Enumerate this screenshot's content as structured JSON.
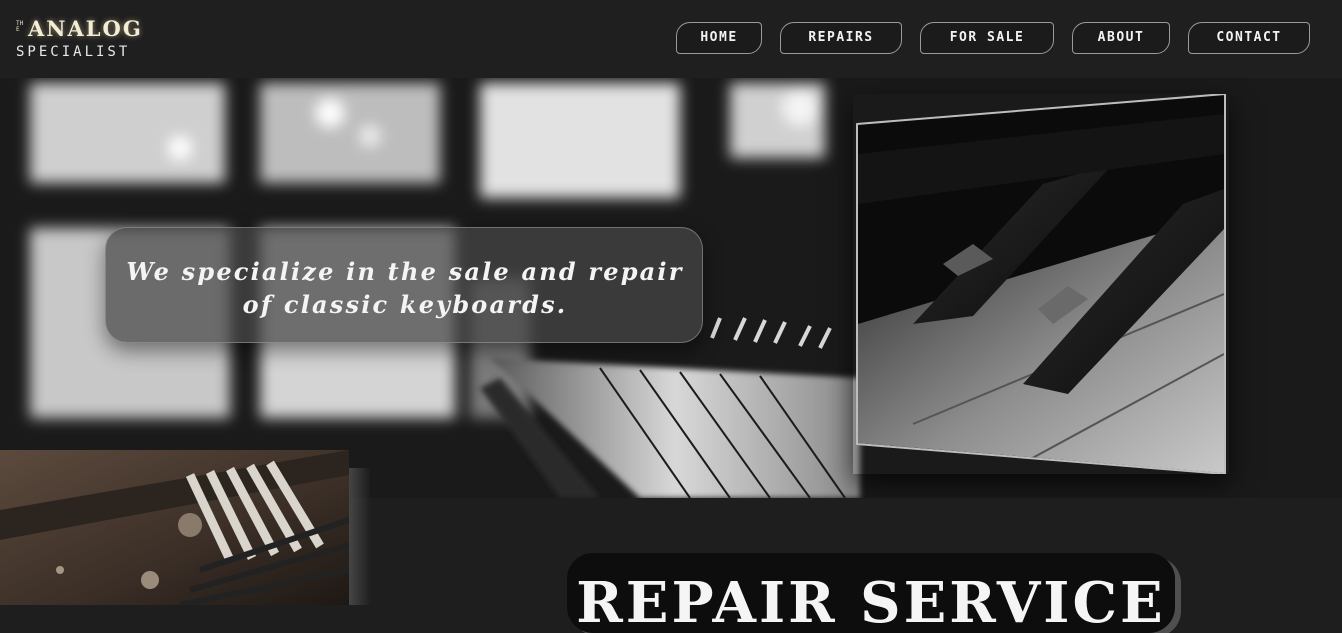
{
  "brand": {
    "the": "THE",
    "analog": "ANALOG",
    "specialist": "SPECIALIST"
  },
  "nav": {
    "items": [
      {
        "label": "HOME"
      },
      {
        "label": "REPAIRS"
      },
      {
        "label": "FOR SALE"
      },
      {
        "label": "ABOUT"
      },
      {
        "label": "CONTACT"
      }
    ]
  },
  "hero": {
    "caption": "We specialize in the sale and repair of classic keyboards."
  },
  "repair": {
    "title": "REPAIR SERVICE"
  }
}
